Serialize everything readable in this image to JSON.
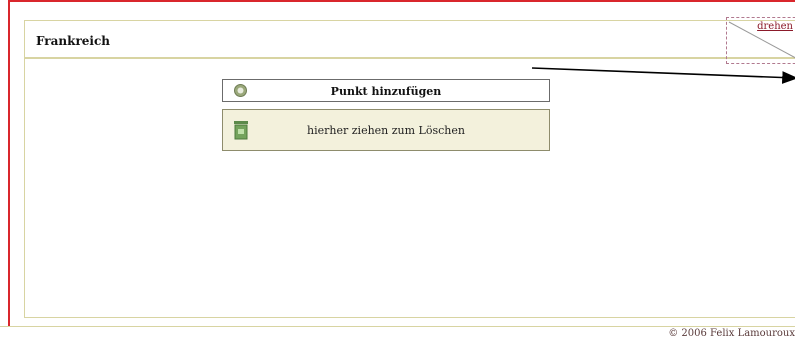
{
  "header": {
    "title": "Frankreich"
  },
  "rotate": {
    "label": "drehen"
  },
  "actions": {
    "add_point_label": "Punkt hinzufügen",
    "drop_delete_label": "hierher ziehen zum Löschen"
  },
  "footer": {
    "copyright": "© 2006 Felix Lamouroux"
  },
  "icons": {
    "add": "plus-circle-icon",
    "trash": "trash-can-icon"
  },
  "colors": {
    "border": "#d8d4a2",
    "accent_red": "#d9262c",
    "drop_zone_bg": "#f3f1dc"
  }
}
